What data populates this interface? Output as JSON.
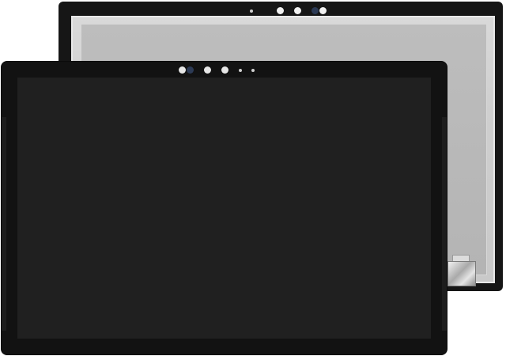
{
  "image": {
    "subject": "tablet-lcd-touch-screen-digitizer-assembly",
    "views": [
      "back-panel",
      "front-panel"
    ]
  },
  "colors": {
    "background": "#ffffff",
    "bezel": "#121212",
    "screen_off": "#202020",
    "back_panel_plate": "#c9c9c9",
    "sensor_light": "#e6e6e6",
    "sensor_dark": "#2c3a55"
  }
}
